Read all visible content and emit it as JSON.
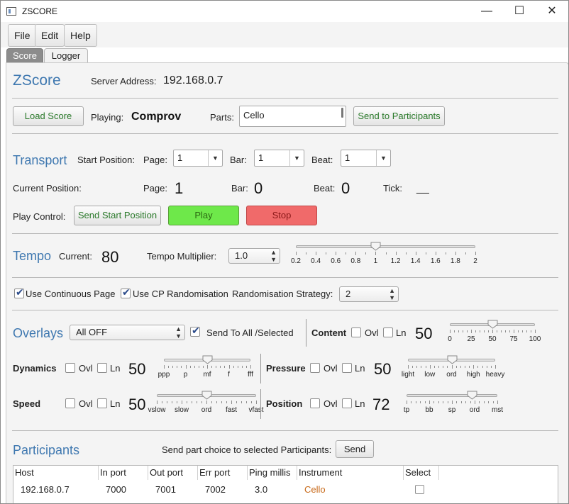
{
  "window": {
    "title": "ZSCORE",
    "minimize": "—",
    "maximize": "☐",
    "close": "✕"
  },
  "menu": [
    "File",
    "Edit",
    "Help"
  ],
  "tabs": [
    "Score",
    "Logger"
  ],
  "header": {
    "app_name": "ZScore",
    "server_label": "Server Address:",
    "server_value": "192.168.0.7"
  },
  "score": {
    "load_button": "Load Score",
    "playing_label": "Playing:",
    "playing_value": "Comprov",
    "parts_label": "Parts:",
    "parts_value": "Cello",
    "send_button": "Send to Participants"
  },
  "transport": {
    "title": "Transport",
    "start_label": "Start Position:",
    "page_label": "Page:",
    "page_value": "1",
    "bar_label": "Bar:",
    "bar_value": "1",
    "beat_label": "Beat:",
    "beat_value": "1",
    "current_label": "Current Position:",
    "cur_page_label": "Page:",
    "cur_page_value": "1",
    "cur_bar_label": "Bar:",
    "cur_bar_value": "0",
    "cur_beat_label": "Beat:",
    "cur_beat_value": "0",
    "tick_label": "Tick:",
    "tick_value": "__",
    "play_control_label": "Play Control:",
    "send_start_button": "Send Start Position",
    "play_button": "Play",
    "stop_button": "Stop"
  },
  "tempo": {
    "title": "Tempo",
    "current_label": "Current:",
    "current_value": "80",
    "multiplier_label": "Tempo Multiplier:",
    "multiplier_value": "1.0",
    "slider_labels": [
      "0.2",
      "0.4",
      "0.6",
      "0.8",
      "1",
      "1.2",
      "1.4",
      "1.6",
      "1.8",
      "2"
    ],
    "slider_value": 1.0
  },
  "options": {
    "continuous_page": "Use Continuous Page",
    "cp_randomisation": "Use CP Randomisation",
    "strategy_label": "Randomisation Strategy:",
    "strategy_value": "2"
  },
  "overlays": {
    "title": "Overlays",
    "all_value": "All OFF",
    "send_all_label": "Send To All /Selected",
    "content": {
      "label": "Content",
      "ovl": "Ovl",
      "ln": "Ln",
      "value": "50",
      "ticks": [
        "0",
        "25",
        "50",
        "75",
        "100"
      ],
      "level": 50
    },
    "dynamics": {
      "label": "Dynamics",
      "ovl": "Ovl",
      "ln": "Ln",
      "value": "50",
      "ticks": [
        "ppp",
        "p",
        "mf",
        "f",
        "fff"
      ],
      "level": 50
    },
    "pressure": {
      "label": "Pressure",
      "ovl": "Ovl",
      "ln": "Ln",
      "value": "50",
      "ticks": [
        "light",
        "low",
        "ord",
        "high",
        "heavy"
      ],
      "level": 50
    },
    "speed": {
      "label": "Speed",
      "ovl": "Ovl",
      "ln": "Ln",
      "value": "50",
      "ticks": [
        "vslow",
        "slow",
        "ord",
        "fast",
        "vfast"
      ],
      "level": 50
    },
    "position": {
      "label": "Position",
      "ovl": "Ovl",
      "ln": "Ln",
      "value": "72",
      "ticks": [
        "tp",
        "bb",
        "sp",
        "ord",
        "mst"
      ],
      "level": 72
    }
  },
  "participants": {
    "title": "Participants",
    "send_label": "Send part choice to selected Participants:",
    "send_button": "Send",
    "columns": [
      "Host",
      "In port",
      "Out port",
      "Err port",
      "Ping millis",
      "Instrument",
      "Select"
    ],
    "rows": [
      {
        "host": "192.168.0.7",
        "in_port": "7000",
        "out_port": "7001",
        "err_port": "7002",
        "ping": "3.0",
        "instrument": "Cello"
      }
    ]
  },
  "colors": {
    "accent": "#3f78b0",
    "play": "#6ee84a",
    "stop": "#f06a6a",
    "instrument": "#c86a1a"
  }
}
